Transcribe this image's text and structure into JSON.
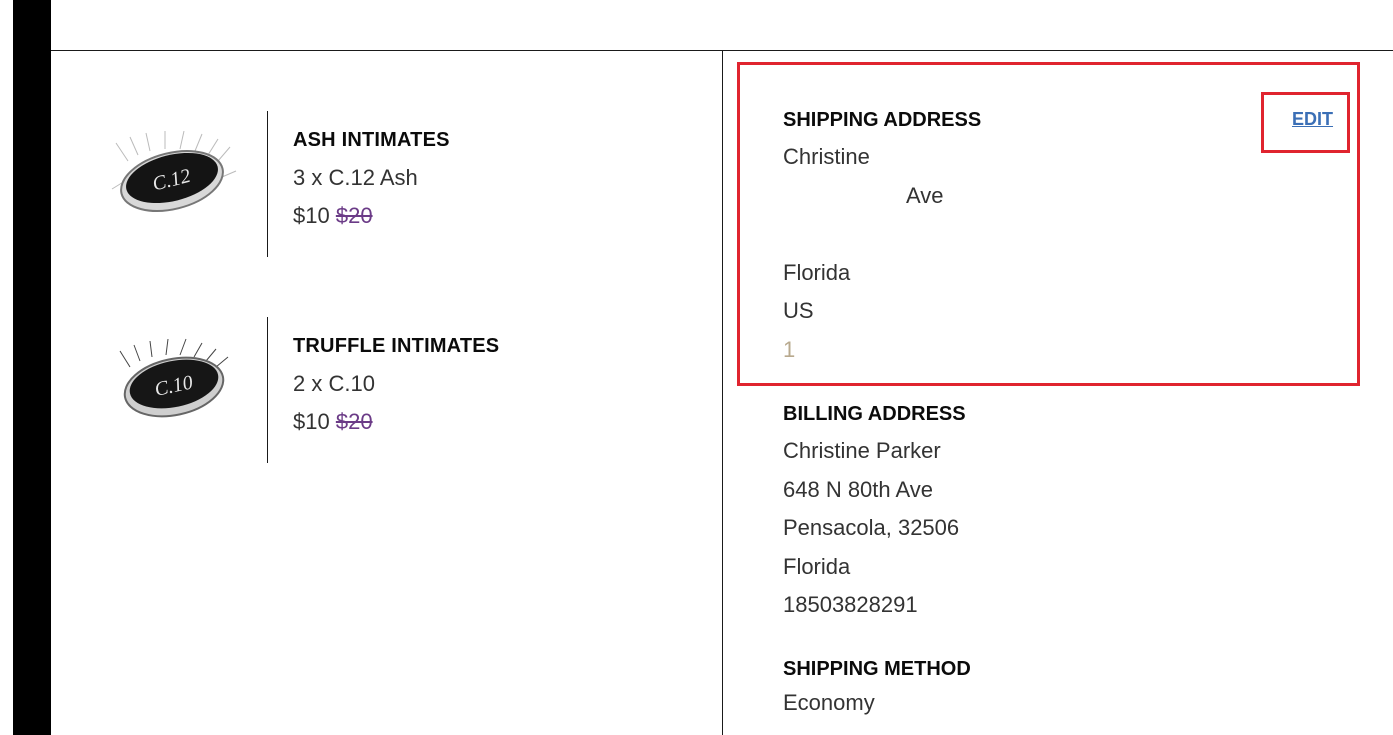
{
  "items": [
    {
      "name": "ASH INTIMATES",
      "variant": "3 x C.12 Ash",
      "price": "$10",
      "original_price": "$20",
      "thumb_icon": "lash-case-icon",
      "thumb_label": "C.12"
    },
    {
      "name": "TRUFFLE INTIMATES",
      "variant": "2 x C.10",
      "price": "$10",
      "original_price": "$20",
      "thumb_icon": "lash-case-icon",
      "thumb_label": "C.10"
    }
  ],
  "shipping": {
    "title": "SHIPPING ADDRESS",
    "edit_label": "EDIT",
    "name": "Christine",
    "street": "Ave",
    "state": "Florida",
    "country": "US",
    "phone": "1"
  },
  "billing": {
    "title": "BILLING ADDRESS",
    "name": "Christine Parker",
    "street": "648 N 80th Ave",
    "city_zip": "Pensacola, 32506",
    "state": "Florida",
    "phone": "18503828291"
  },
  "shipping_method": {
    "title": "SHIPPING METHOD",
    "value": "Economy"
  },
  "colors": {
    "highlight": "#e0242f",
    "link": "#3b6fb6",
    "strike_price": "#6b3b87"
  }
}
